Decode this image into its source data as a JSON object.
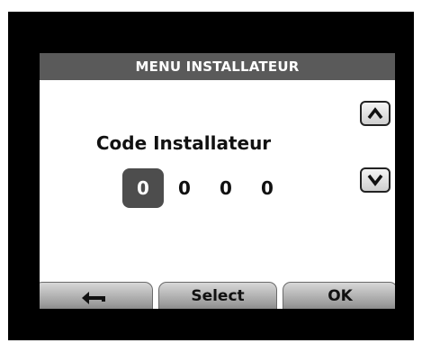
{
  "header": {
    "title": "MENU INSTALLATEUR"
  },
  "main": {
    "label": "Code Installateur",
    "digits": [
      "0",
      "0",
      "0",
      "0"
    ],
    "active_digit_index": 0
  },
  "side_buttons": {
    "up_icon": "chevron-up-icon",
    "down_icon": "chevron-down-icon"
  },
  "softkeys": {
    "back_icon": "back-arrow-icon",
    "select_label": "Select",
    "ok_label": "OK"
  },
  "colors": {
    "bezel": "#000000",
    "title_bar": "#5a5a5a",
    "active_digit_bg": "#4d4d4d",
    "screen": "#ffffff"
  }
}
